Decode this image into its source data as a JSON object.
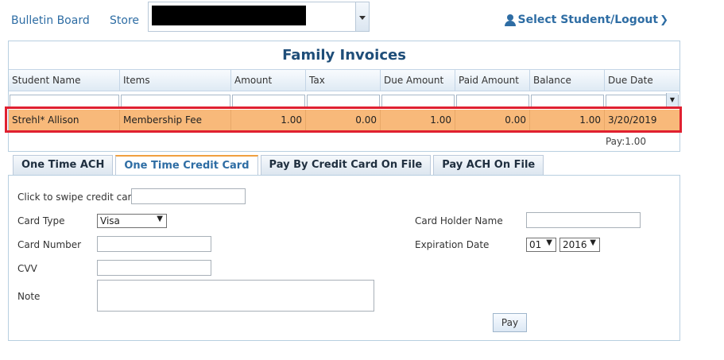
{
  "nav": {
    "bulletin": "Bulletin Board",
    "store": "Store",
    "user_menu": "Select Student/Logout"
  },
  "grid": {
    "title": "Family Invoices",
    "columns": [
      "Student Name",
      "Items",
      "Amount",
      "Tax",
      "Due Amount",
      "Paid Amount",
      "Balance",
      "Due Date"
    ],
    "row": {
      "student": "Strehl* Allison",
      "items": "Membership Fee",
      "amount": "1.00",
      "tax": "0.00",
      "due": "1.00",
      "paid": "0.00",
      "balance": "1.00",
      "due_date": "3/20/2019"
    },
    "pay_total": "Pay:1.00"
  },
  "tabs": [
    "One Time ACH",
    "One Time Credit Card",
    "Pay By Credit Card On File",
    "Pay ACH On File"
  ],
  "active_tab": "One Time Credit Card",
  "form": {
    "swipe_label": "Click to swipe credit card",
    "card_type_label": "Card Type",
    "card_type_value": "Visa",
    "card_number_label": "Card Number",
    "cvv_label": "CVV",
    "note_label": "Note",
    "holder_label": "Card Holder Name",
    "expiration_label": "Expiration Date",
    "exp_month": "01",
    "exp_year": "2016",
    "pay_button": "Pay"
  },
  "colors": {
    "accent": "#2e6da4",
    "row_highlight": "#f8b97a",
    "selection_border": "#e02030",
    "active_tab_top": "#f0a040"
  }
}
